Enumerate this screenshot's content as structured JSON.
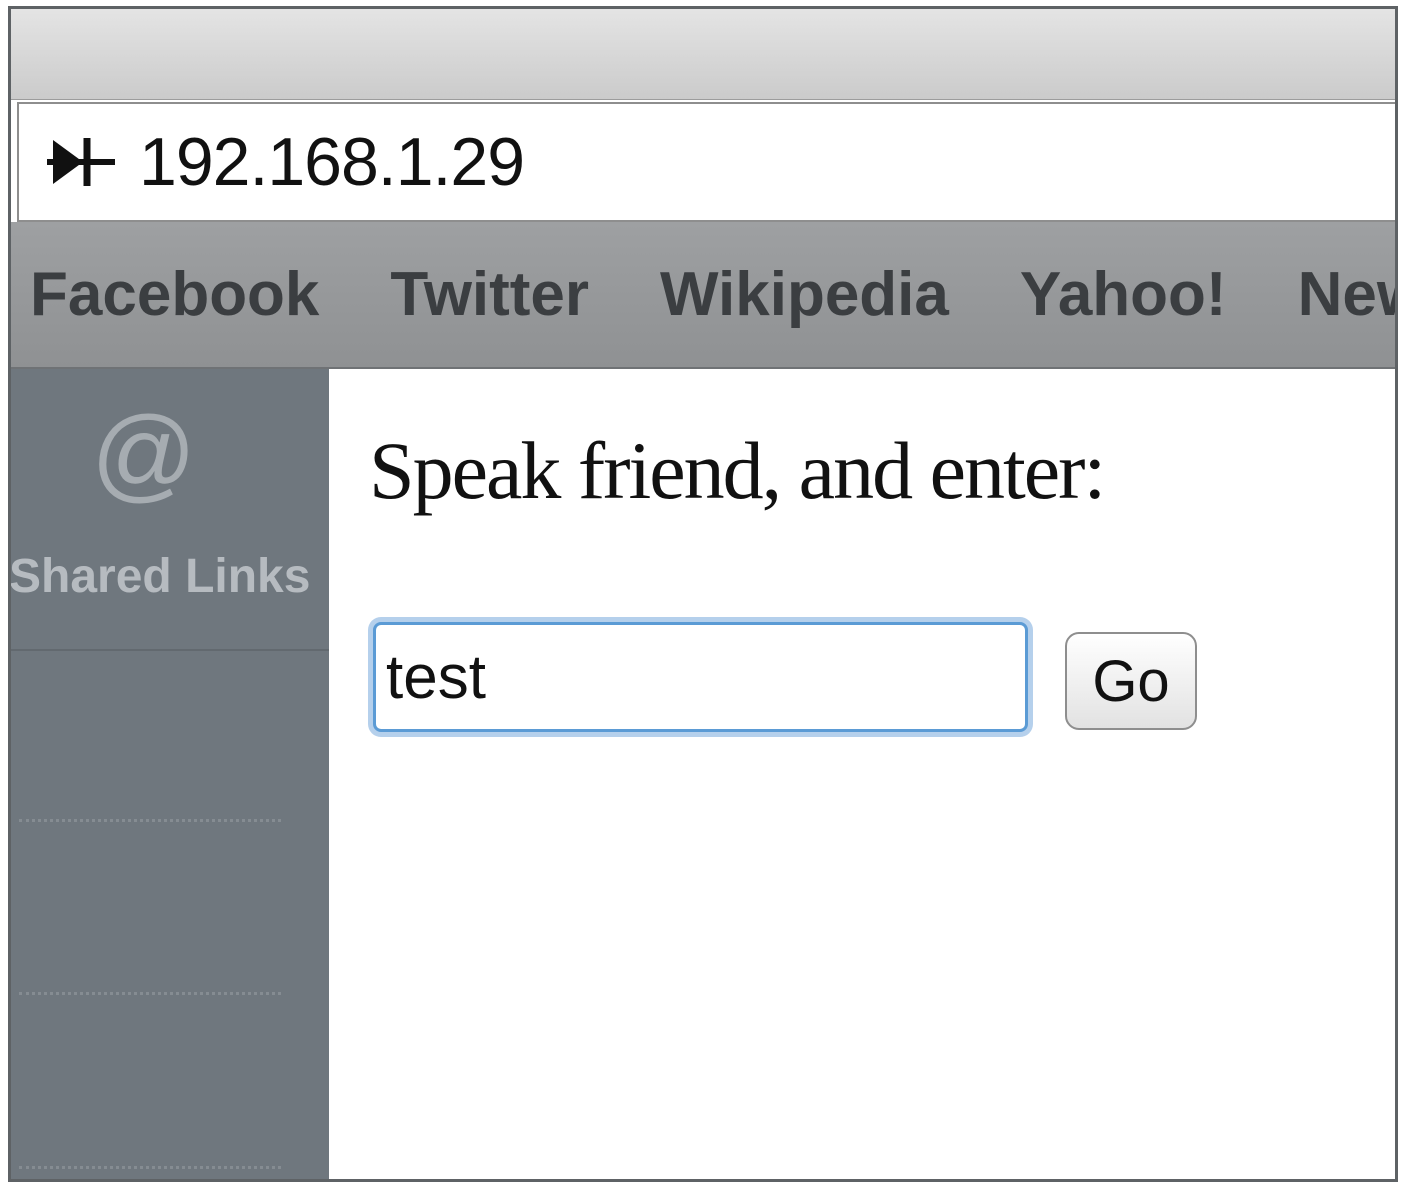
{
  "address_bar": {
    "url": "192.168.1.29",
    "site_icon": "network-diode-icon"
  },
  "bookmarks": [
    {
      "label": "Facebook"
    },
    {
      "label": "Twitter"
    },
    {
      "label": "Wikipedia"
    },
    {
      "label": "Yahoo!"
    },
    {
      "label": "News",
      "has_dropdown": true
    }
  ],
  "sidebar": {
    "icon": "at-sign-icon",
    "icon_glyph": "@",
    "label": "Shared Links"
  },
  "page": {
    "prompt": "Speak friend, and enter:",
    "input_value": "test",
    "button_label": "Go"
  }
}
